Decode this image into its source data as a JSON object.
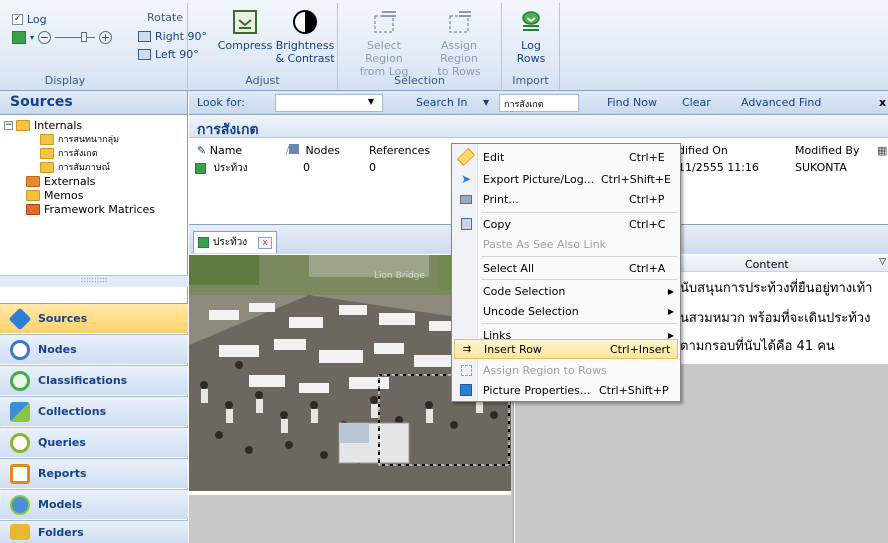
{
  "ribbon": {
    "display": {
      "caption": "Display",
      "log_label": "Log",
      "log_checked": true
    },
    "rotate": {
      "label": "Rotate",
      "right": "Right 90°",
      "left": "Left 90°"
    },
    "adjust": {
      "caption": "Adjust",
      "compress": "Compress",
      "brightness_line1": "Brightness",
      "brightness_line2": "& Contrast"
    },
    "selection": {
      "caption": "Selection",
      "select_region_line1": "Select Region",
      "select_region_line2": "from Log",
      "assign_region_line1": "Assign Region",
      "assign_region_line2": "to Rows"
    },
    "import": {
      "caption": "Import",
      "log_rows_line1": "Log",
      "log_rows_line2": "Rows"
    }
  },
  "nav": {
    "title": "Sources",
    "tree": {
      "internals": "Internals",
      "children": [
        "การสนทนากลุ่ม",
        "การสังเกต",
        "การสัมภาษณ์"
      ],
      "externals": "Externals",
      "memos": "Memos",
      "framework": "Framework Matrices"
    },
    "buttons": [
      {
        "label": "Sources",
        "color": "#2c7fd6"
      },
      {
        "label": "Nodes",
        "color": "#3a78c9"
      },
      {
        "label": "Classifications",
        "color": "#48a848"
      },
      {
        "label": "Collections",
        "color": "#3b8fd9"
      },
      {
        "label": "Queries",
        "color": "#8bb52a"
      },
      {
        "label": "Reports",
        "color": "#e08a1c"
      },
      {
        "label": "Models",
        "color": "#4a90d9"
      },
      {
        "label": "Folders",
        "color": "#e8b830"
      }
    ],
    "splitter_dots": "::::::::::"
  },
  "findbar": {
    "look_for": "Look for:",
    "search_in": "Search In",
    "search_in_value": "การสังเกต",
    "find_now": "Find Now",
    "clear": "Clear",
    "advanced_find": "Advanced Find",
    "close": "x"
  },
  "list": {
    "title": "การสังเกต",
    "columns": {
      "name": "Name",
      "nodes": "Nodes",
      "references": "References",
      "modified_on": "dified On",
      "modified_by": "Modified By"
    },
    "row": {
      "name": "ประท้วง",
      "nodes": "0",
      "references": "0",
      "modified_on": "11/2555 11:16",
      "modified_by": "SUKONTA"
    }
  },
  "detail": {
    "tab_label": "ประท้วง",
    "tab_close": "x",
    "content_header": "Content",
    "content_lines": [
      "นับสนุนการประท้วงที่ยืนอยู่ทางเท้า",
      "นสวมหมวก พร้อมที่จะเดินประท้วง",
      "ตามกรอบที่นับได้คือ 41 คน"
    ],
    "picture_caption": "Lion Bridge"
  },
  "context_menu": {
    "items": [
      {
        "label": "Edit",
        "shortcut": "Ctrl+E"
      },
      {
        "label": "Export Picture/Log...",
        "shortcut": "Ctrl+Shift+E"
      },
      {
        "label": "Print...",
        "shortcut": "Ctrl+P"
      },
      {
        "label": "Copy",
        "shortcut": "Ctrl+C"
      },
      {
        "label": "Paste As See Also Link",
        "shortcut": ""
      },
      {
        "label": "Select All",
        "shortcut": "Ctrl+A"
      },
      {
        "label": "Code Selection",
        "shortcut": ""
      },
      {
        "label": "Uncode Selection",
        "shortcut": ""
      },
      {
        "label": "Links",
        "shortcut": ""
      },
      {
        "label": "Insert Row",
        "shortcut": "Ctrl+Insert"
      },
      {
        "label": "Assign Region to Rows",
        "shortcut": ""
      },
      {
        "label": "Picture Properties...",
        "shortcut": "Ctrl+Shift+P"
      }
    ]
  }
}
